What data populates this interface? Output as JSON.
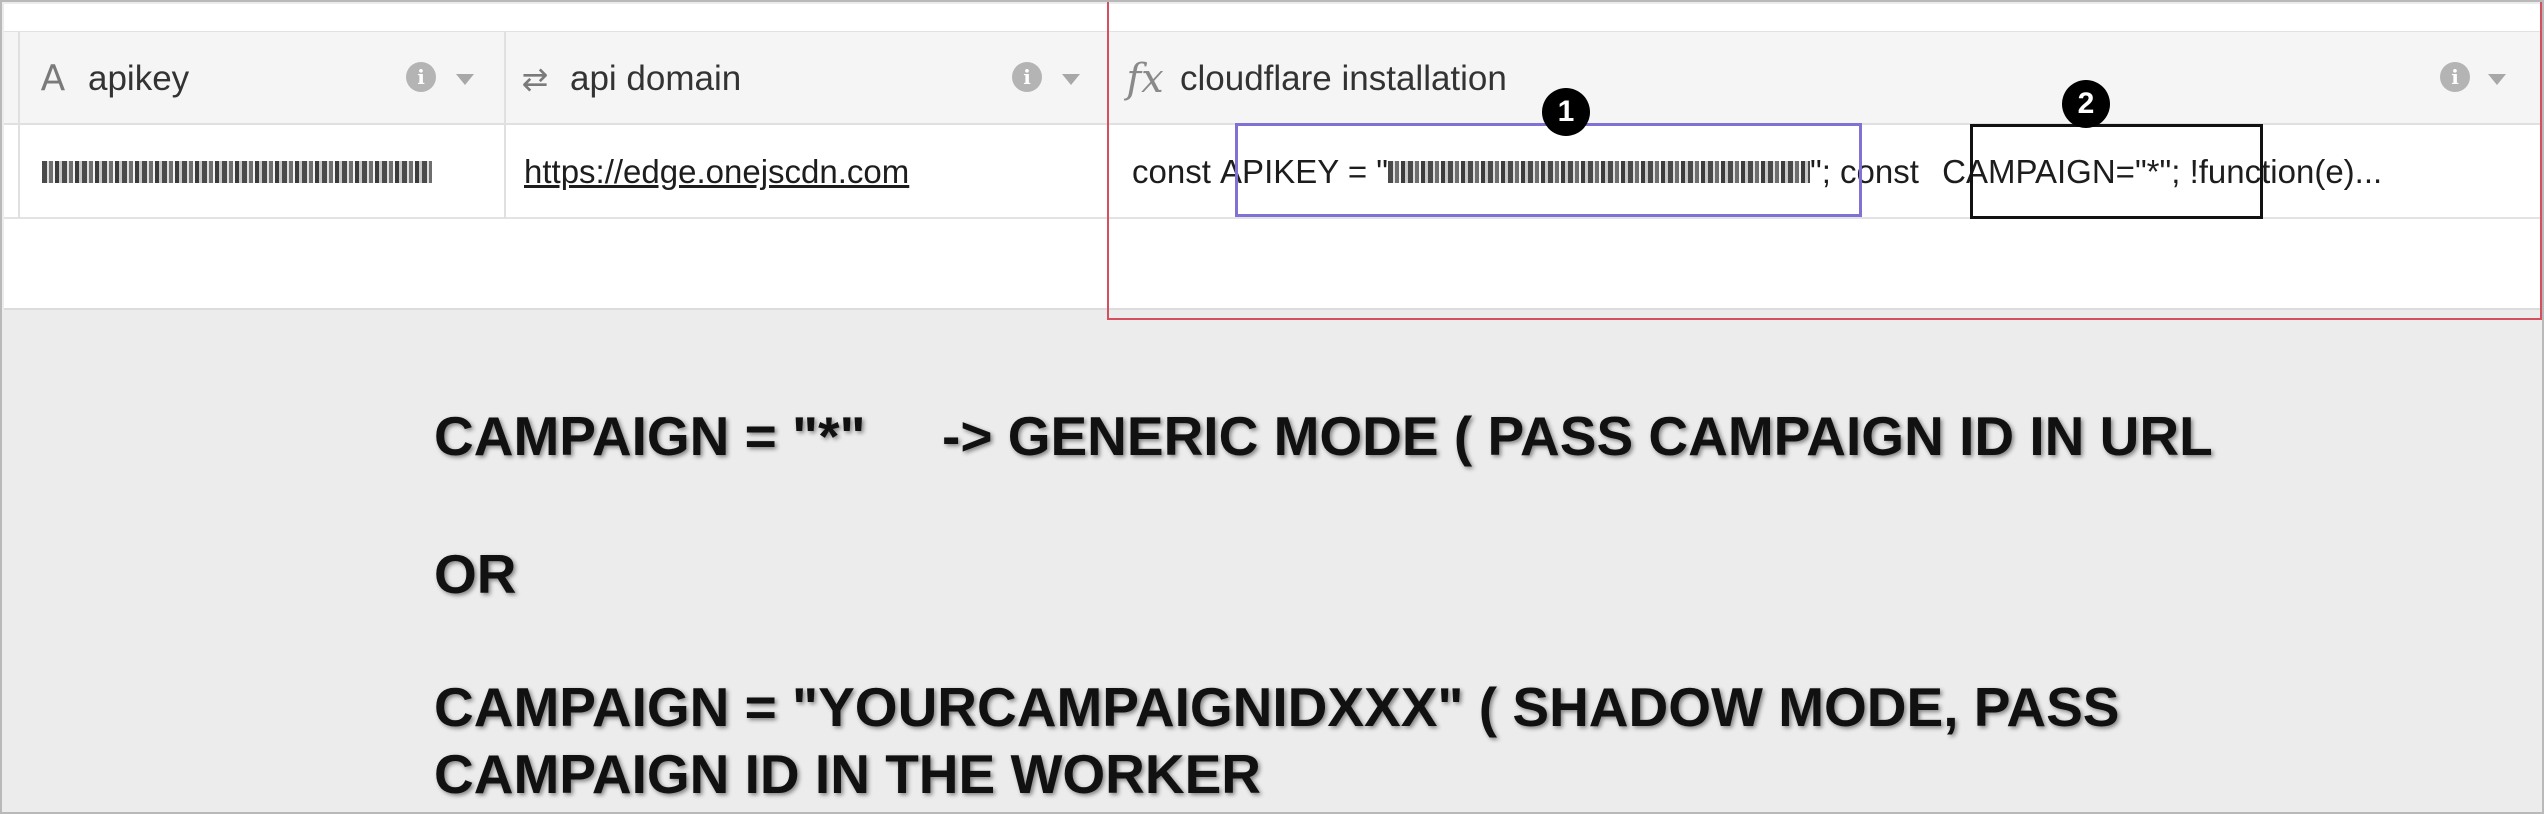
{
  "columns": [
    {
      "icon": "text-field-icon",
      "glyph": "A",
      "label": "apikey"
    },
    {
      "icon": "link-field-icon",
      "glyph": "⇄",
      "label": "api domain"
    },
    {
      "icon": "formula-field-icon",
      "glyph": "fx",
      "label": "cloudflare installation"
    }
  ],
  "info_glyph": "i",
  "row": {
    "apikey": "[redacted]",
    "api_domain": "https://edge.onejscdn.com",
    "install_const1": "const ",
    "install_apikey_prefix": "APIKEY = \"",
    "install_apikey_suffix": "\";",
    "install_const2": " const ",
    "install_campaign": "CAMPAIGN=\"*\";",
    "install_rest": " !function(e)..."
  },
  "badges": {
    "one": "1",
    "two": "2"
  },
  "notes": {
    "line1": "CAMPAIGN = \"*\"     -> GENERIC MODE ( PASS CAMPAIGN ID IN URL",
    "line2": "OR",
    "line3": "CAMPAIGN = \"YOURCAMPAIGNIDXXX\" ( SHADOW MODE, PASS",
    "line4": "CAMPAIGN ID IN THE WORKER"
  },
  "colors": {
    "red_box": "#d4505e",
    "purple_box": "#7f72d2",
    "black_box": "#111111"
  }
}
